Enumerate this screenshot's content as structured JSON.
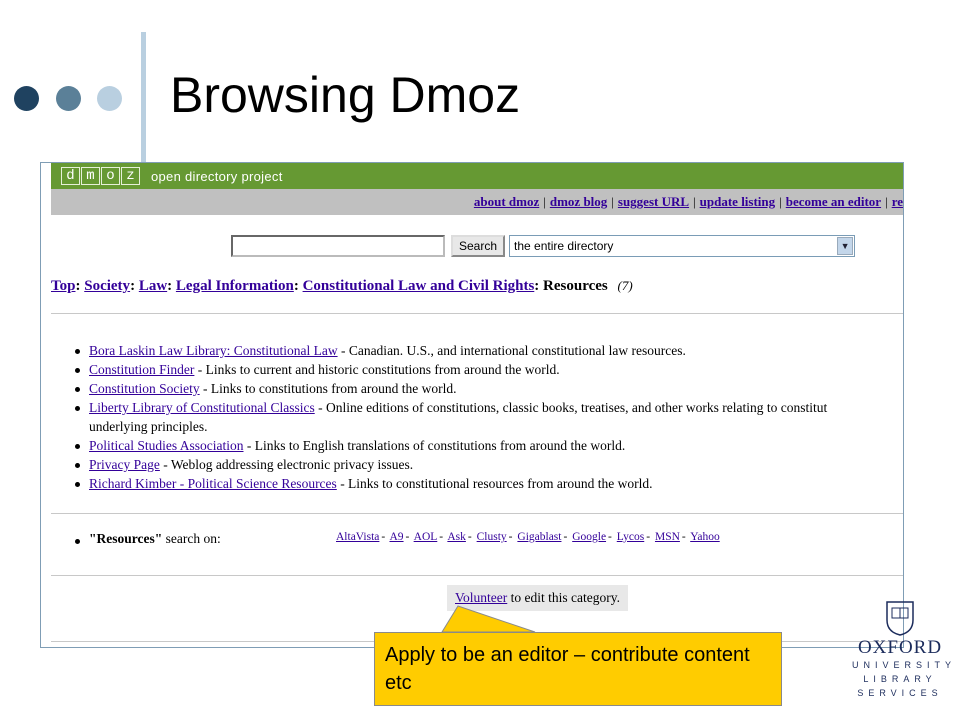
{
  "slide": {
    "title": "Browsing Dmoz",
    "dots": [
      "#1f4260",
      "#5b8098",
      "#b9cfe0"
    ]
  },
  "dmoz": {
    "logo_letters": [
      "d",
      "m",
      "o",
      "z"
    ],
    "tagline": "open directory project",
    "top_links": [
      "about dmoz",
      "dmoz blog",
      "suggest URL",
      "update listing",
      "become an editor",
      "re"
    ],
    "search": {
      "input_value": "",
      "button_label": "Search",
      "scope_selected": "the entire directory"
    },
    "breadcrumb": {
      "links": [
        "Top",
        "Society",
        "Law",
        "Legal Information",
        "Constitutional Law and Civil Rights"
      ],
      "current": "Resources",
      "count": "(7)"
    },
    "resources": [
      {
        "title": "Bora Laskin Law Library: Constitutional Law",
        "desc": " - Canadian. U.S., and international constitutional law resources."
      },
      {
        "title": "Constitution Finder",
        "desc": " - Links to current and historic constitutions from around the world."
      },
      {
        "title": "Constitution Society",
        "desc": " - Links to constitutions from around the world."
      },
      {
        "title": "Liberty Library of Constitutional Classics",
        "desc": " - Online editions of constitutions, classic books, treatises, and other works relating to constitut",
        "desc_cont": "underlying principles."
      },
      {
        "title": "Political Studies Association",
        "desc": " - Links to English translations of constitutions from around the world."
      },
      {
        "title": "Privacy Page",
        "desc": " - Weblog addressing electronic privacy issues."
      },
      {
        "title": "Richard Kimber - Political Science Resources",
        "desc": " - Links to constitutional resources from around the world."
      }
    ],
    "search_on_label": "\"Resources\" search on:",
    "search_on_bold": "\"Resources\"",
    "search_on_rest": " search on:",
    "engines": [
      "AltaVista",
      "A9",
      "AOL",
      "Ask",
      "Clusty",
      "Gigablast",
      "Google",
      "Lycos",
      "MSN",
      "Yahoo"
    ],
    "volunteer": {
      "link": "Volunteer",
      "rest": " to edit this category."
    }
  },
  "callout": {
    "text": "Apply to be an editor – contribute content etc",
    "color": "#ffcc00"
  },
  "oxford_logo": {
    "name": "OXFORD",
    "line1": "UNIVERSITY",
    "line2": "LIBRARY",
    "line3": "SERVICES"
  }
}
